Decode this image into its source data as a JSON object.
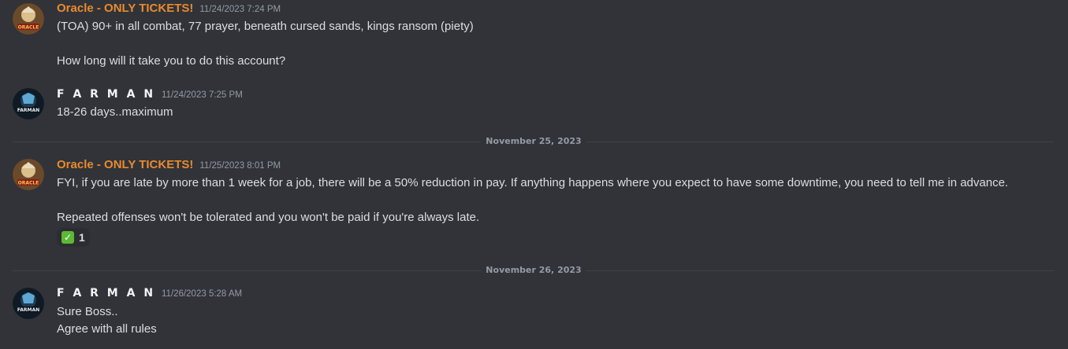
{
  "messages": [
    {
      "author": "Oracle - ONLY TICKETS!",
      "timestamp": "11/24/2023 7:24 PM",
      "lines": [
        "(TOA) 90+ in all combat, 77 prayer, beneath cursed sands, kings ransom (piety)",
        "How long will it take you to do this account?"
      ]
    },
    {
      "author": "F A R M A N",
      "timestamp": "11/24/2023 7:25 PM",
      "lines": [
        "18-26 days..maximum"
      ]
    },
    {
      "author": "Oracle - ONLY TICKETS!",
      "timestamp": "11/25/2023 8:01 PM",
      "lines": [
        "FYI, if you are late by more than 1 week for a job, there will be a 50% reduction in pay. If anything happens where you expect to have some downtime, you need to tell me in advance.",
        "Repeated offenses won't be tolerated and you won't be paid if you're always late."
      ],
      "reaction": {
        "emoji": "check-mark-icon",
        "count": "1"
      }
    },
    {
      "author": "F A R M A N",
      "timestamp": "11/26/2023 5:28 AM",
      "lines": [
        "Sure Boss..",
        "Agree with all rules"
      ]
    }
  ],
  "dividers": [
    "November 25, 2023",
    "November 26, 2023"
  ],
  "colors": {
    "background": "#313338",
    "oracle_name": "#e88a2f",
    "text": "#dbdee1",
    "muted": "#949ba4"
  }
}
